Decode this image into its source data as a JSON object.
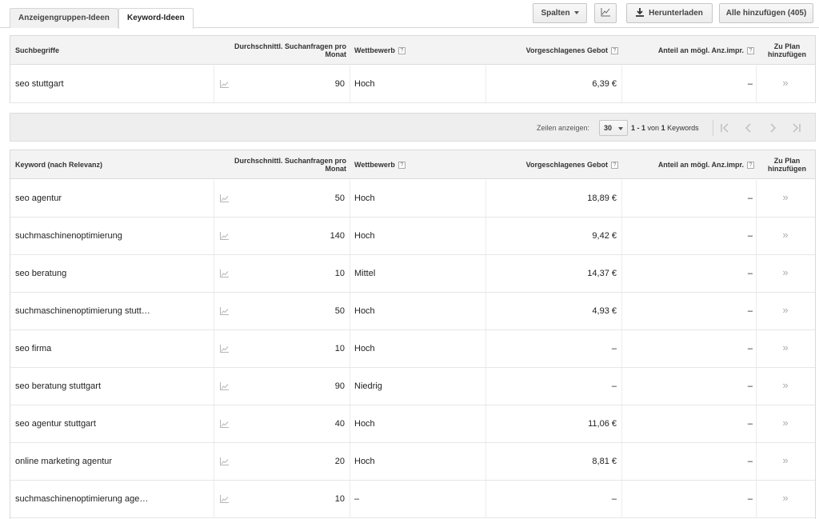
{
  "tabs": [
    {
      "label": "Anzeigengruppen-Ideen",
      "active": false
    },
    {
      "label": "Keyword-Ideen",
      "active": true
    }
  ],
  "toolbar": {
    "columns_label": "Spalten",
    "download_label": "Herunterladen",
    "add_all_label": "Alle hinzufügen (405)"
  },
  "search_table": {
    "headers": {
      "term": "Suchbegriffe",
      "searches": "Durchschnittl. Suchanfragen pro Monat",
      "competition": "Wettbewerb",
      "bid": "Vorgeschlagenes Gebot",
      "share": "Anteil an mögl. Anz.impr.",
      "add": "Zu Plan hinzufügen"
    },
    "help_mark": "?",
    "rows": [
      {
        "keyword": "seo stuttgart",
        "searches": "90",
        "competition": "Hoch",
        "bid": "6,39 €",
        "share": "–"
      }
    ]
  },
  "pager": {
    "rows_label": "Zeilen anzeigen:",
    "rows_value": "30",
    "range_start": "1 - 1",
    "range_of": "von",
    "range_total": "1",
    "range_unit": "Keywords"
  },
  "keyword_table": {
    "headers": {
      "term": "Keyword (nach Relevanz)",
      "searches": "Durchschnittl. Suchanfragen pro Monat",
      "competition": "Wettbewerb",
      "bid": "Vorgeschlagenes Gebot",
      "share": "Anteil an mögl. Anz.impr.",
      "add": "Zu Plan hinzufügen"
    },
    "rows": [
      {
        "keyword": "seo agentur",
        "searches": "50",
        "competition": "Hoch",
        "bid": "18,89 €",
        "share": "–"
      },
      {
        "keyword": "suchmaschinenoptimierung",
        "searches": "140",
        "competition": "Hoch",
        "bid": "9,42 €",
        "share": "–"
      },
      {
        "keyword": "seo beratung",
        "searches": "10",
        "competition": "Mittel",
        "bid": "14,37 €",
        "share": "–"
      },
      {
        "keyword": "suchmaschinenoptimierung stutt…",
        "searches": "50",
        "competition": "Hoch",
        "bid": "4,93 €",
        "share": "–"
      },
      {
        "keyword": "seo firma",
        "searches": "10",
        "competition": "Hoch",
        "bid": "–",
        "share": "–"
      },
      {
        "keyword": "seo beratung stuttgart",
        "searches": "90",
        "competition": "Niedrig",
        "bid": "–",
        "share": "–"
      },
      {
        "keyword": "seo agentur stuttgart",
        "searches": "40",
        "competition": "Hoch",
        "bid": "11,06 €",
        "share": "–"
      },
      {
        "keyword": "online marketing agentur",
        "searches": "20",
        "competition": "Hoch",
        "bid": "8,81 €",
        "share": "–"
      },
      {
        "keyword": "suchmaschinenoptimierung age…",
        "searches": "10",
        "competition": "–",
        "bid": "–",
        "share": "–"
      }
    ]
  },
  "add_glyph": "»"
}
